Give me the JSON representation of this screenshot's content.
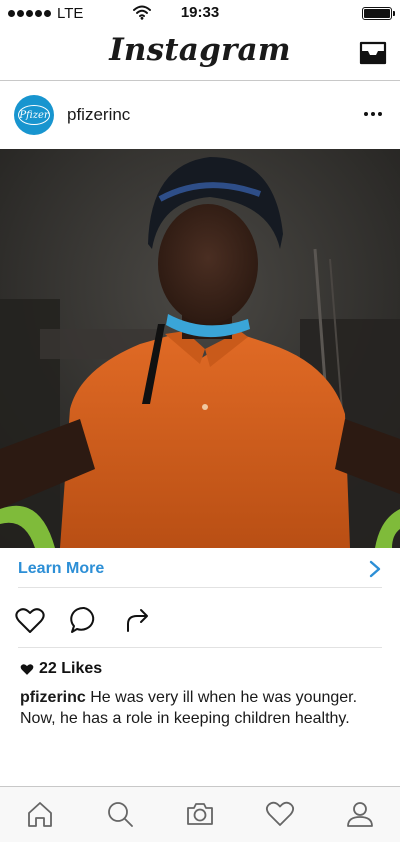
{
  "status_bar": {
    "carrier": "LTE",
    "time": "19:33",
    "battery_level": 1.0
  },
  "header": {
    "title": "Instagram",
    "inbox_icon": "inbox-icon"
  },
  "post": {
    "username": "pfizerinc",
    "avatar_text": "Pfizer",
    "more_icon": "more-dots-icon",
    "photo_alt": "",
    "cta": {
      "label": "Learn More",
      "icon": "chevron-right-icon",
      "accent_color": "#2d8fd6"
    },
    "actions": [
      "heart-icon",
      "comment-icon",
      "share-icon"
    ],
    "likes": "22 Likes",
    "caption": {
      "user": "pfizerinc",
      "text": "He was very ill when he was younger. Now, he has a role in keeping children healthy."
    }
  },
  "tab_bar": {
    "items": [
      {
        "name": "home-icon"
      },
      {
        "name": "search-icon"
      },
      {
        "name": "camera-icon"
      },
      {
        "name": "activity-heart-icon",
        "has_notification": true
      },
      {
        "name": "profile-icon"
      }
    ],
    "notification_color": "#e0403f"
  },
  "brand_colors": {
    "pfizer_blue": "#1895cf",
    "shirt_orange": "#d9621e"
  }
}
